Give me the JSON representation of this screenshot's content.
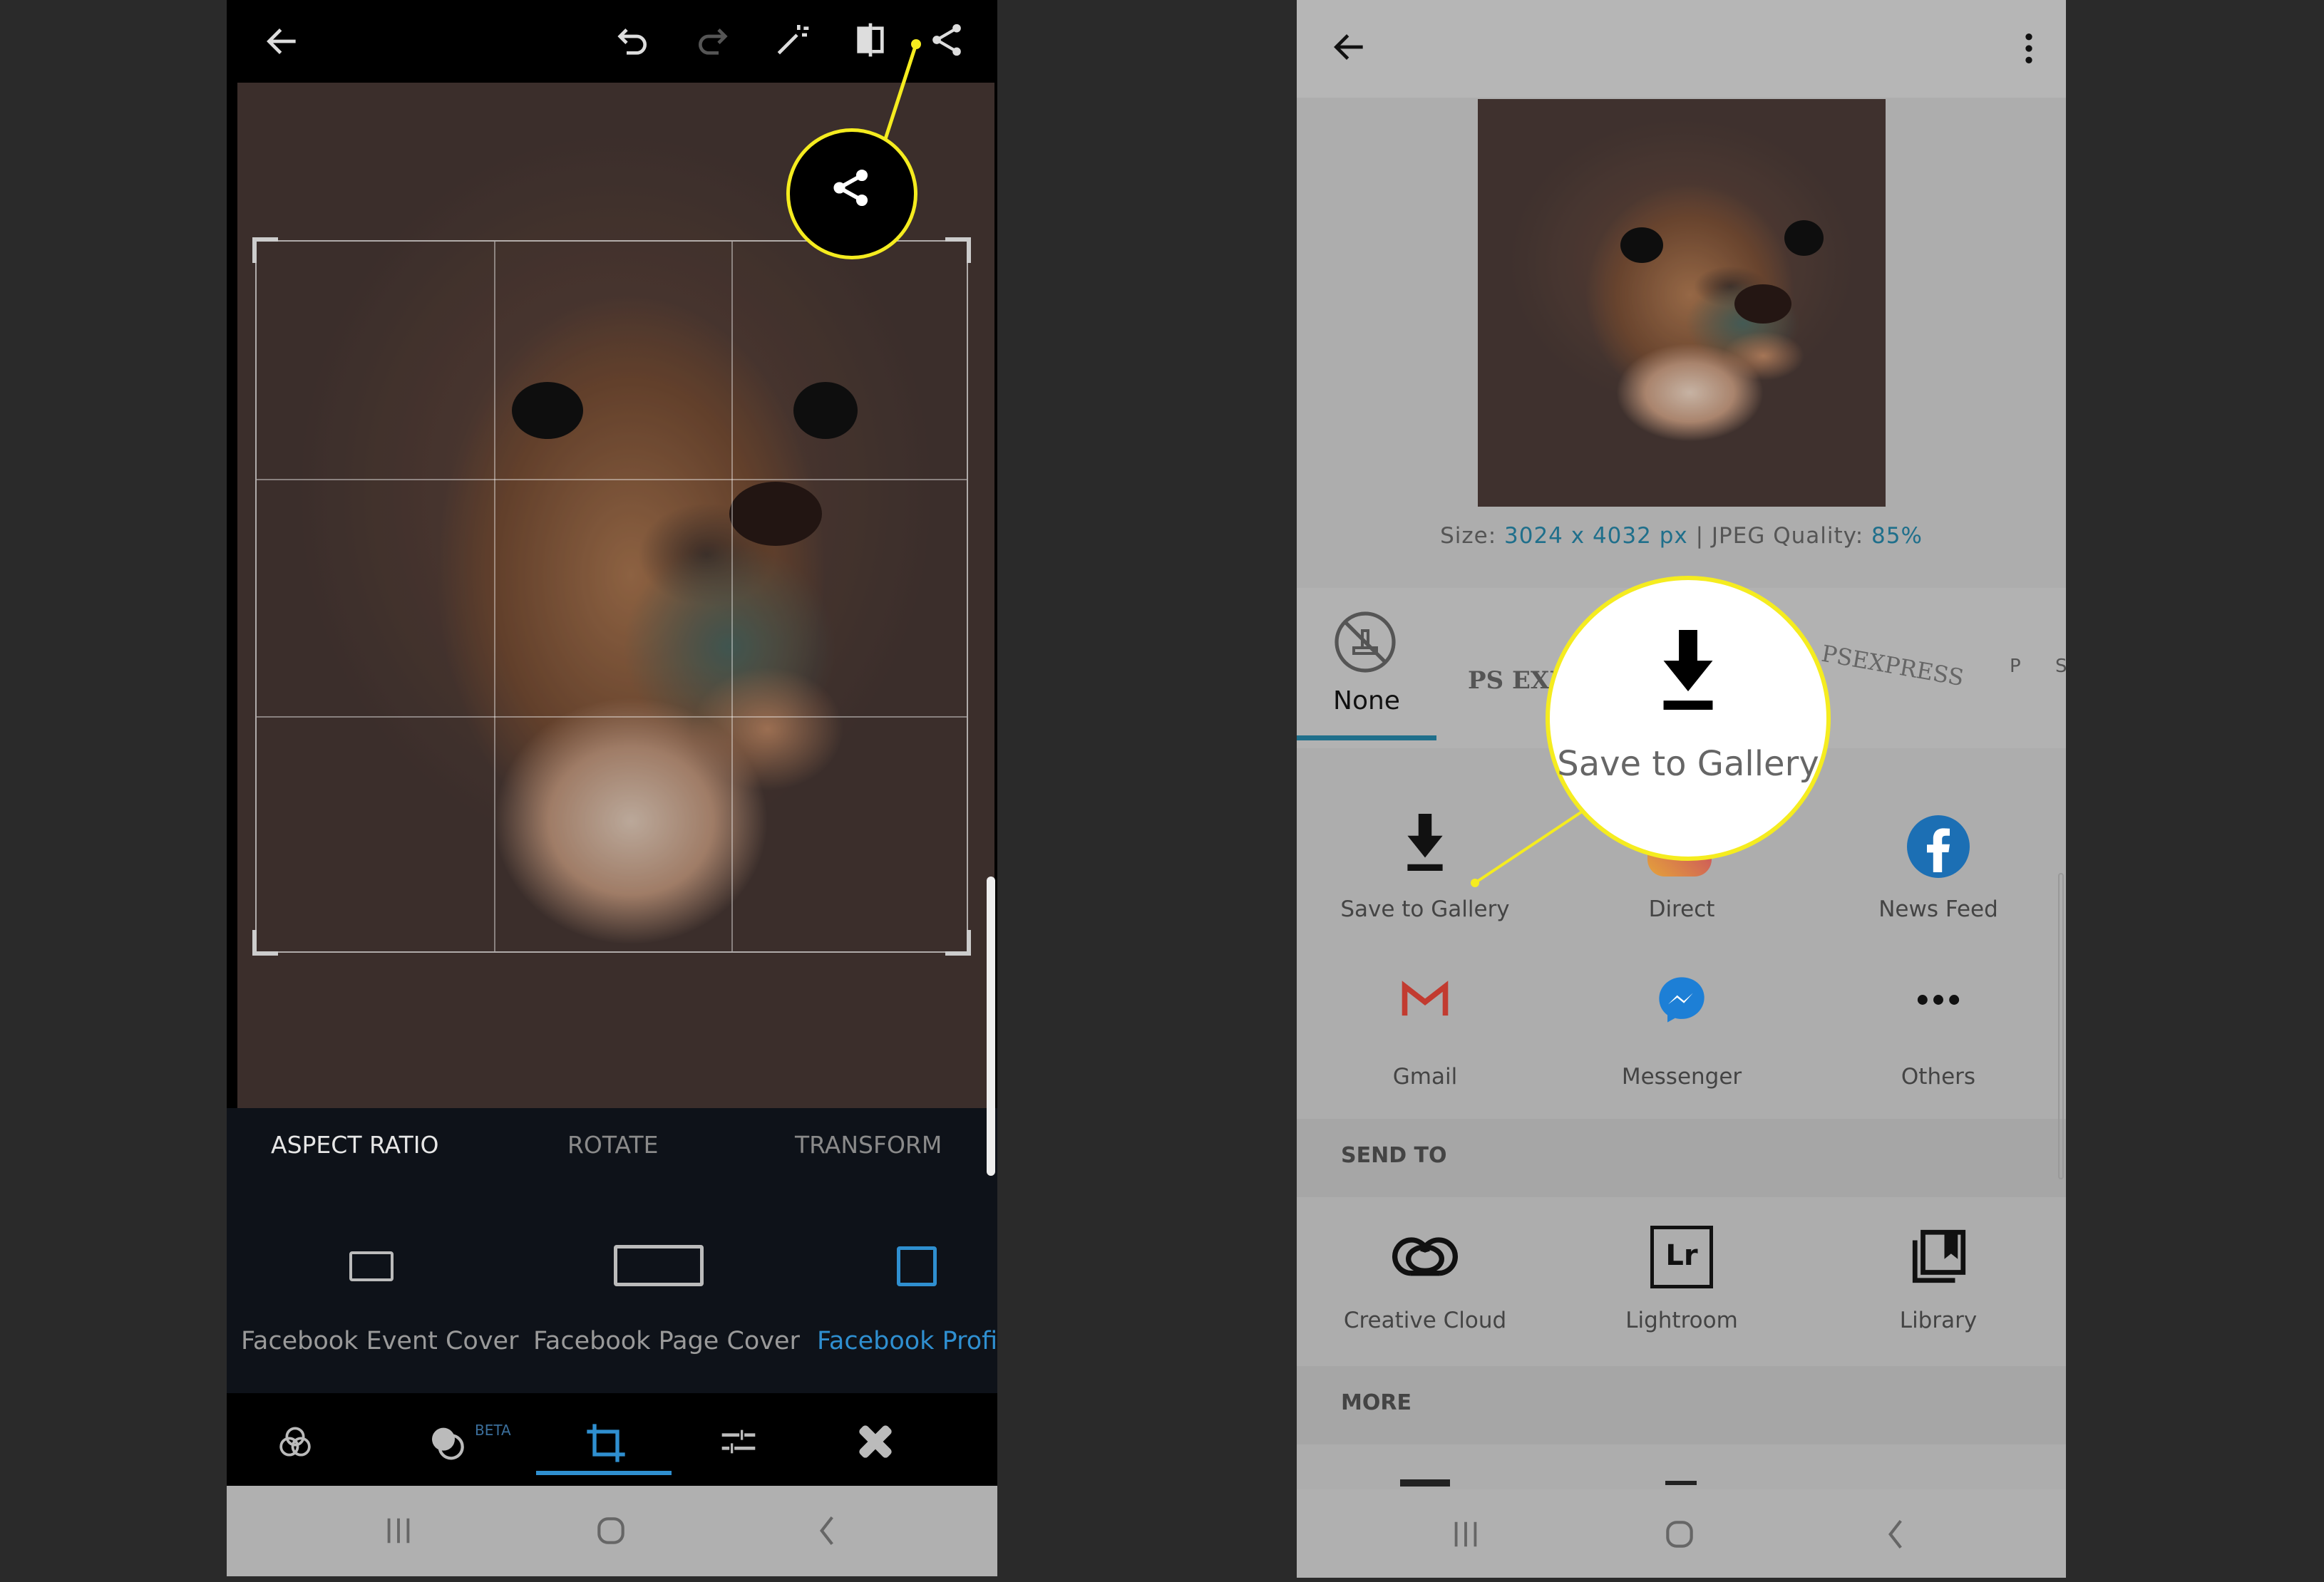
{
  "left": {
    "toolbar_icons": [
      "back-arrow-icon",
      "undo-icon",
      "redo-icon",
      "magic-wand-icon",
      "compare-icon",
      "share-icon"
    ],
    "tabs": [
      {
        "label": "ASPECT RATIO",
        "active": true
      },
      {
        "label": "ROTATE"
      },
      {
        "label": "TRANSFORM"
      }
    ],
    "presets": [
      {
        "label": "Facebook Event Cover"
      },
      {
        "label": "Facebook Page Cover"
      },
      {
        "label": "Facebook Profil",
        "selected": true
      }
    ],
    "bottom_tools": [
      "looks-icon",
      "blend-icon",
      "crop-icon",
      "adjust-icon",
      "heal-icon"
    ],
    "beta_label": "BETA",
    "accent": "#2f8fd0"
  },
  "right": {
    "size_label": "Size:",
    "size_value": "3024 x 4032 px",
    "separator": "|",
    "quality_label": "JPEG Quality:",
    "quality_value": "85%",
    "watermarks": [
      {
        "label": "None",
        "selected": true
      },
      {
        "label": "PS EXPRESS"
      },
      {
        "label": "PSEXPRESS"
      },
      {
        "label": "P S"
      }
    ],
    "share_items": [
      {
        "label": "Save to Gallery"
      },
      {
        "label": "Direct"
      },
      {
        "label": "News Feed"
      },
      {
        "label": "Gmail"
      },
      {
        "label": "Messenger"
      },
      {
        "label": "Others"
      }
    ],
    "send_to_header": "SEND TO",
    "send_to": [
      {
        "label": "Creative Cloud"
      },
      {
        "label": "Lightroom"
      },
      {
        "label": "Library"
      }
    ],
    "lightroom_glyph": "Lr",
    "more_header": "MORE",
    "callout_label": "Save to Gallery",
    "accent": "#1f6f8b",
    "highlight": "#f5ec1f"
  }
}
